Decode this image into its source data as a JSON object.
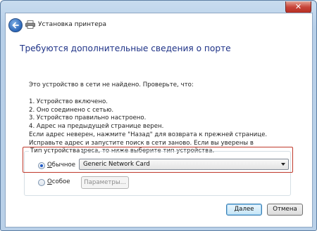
{
  "window": {
    "close_glyph": "✕"
  },
  "wizard": {
    "title": "Установка принтера"
  },
  "heading": "Требуются дополнительные сведения о порте",
  "intro": "Это устройство в сети не найдено. Проверьте, что:",
  "steps": [
    "1.  Устройство включено.",
    "2.  Оно соединено с сетью.",
    "3.  Устройство правильно настроено.",
    "4.  Адрес на предыдущей странице верен."
  ],
  "note": "Если адрес неверен, нажмите \"Назад\" для возврата к прежней странице. Исправьте адрес и запустите поиск в сети заново. Если вы уверены в правильности адреса, то ниже выберите тип устройства.",
  "device_type": {
    "legend": "Тип устройства",
    "standard_label_first": "О",
    "standard_label_rest": "бычное",
    "standard_selected": true,
    "select_value": "Generic Network Card",
    "special_label_first": "О",
    "special_label_rest": "собое",
    "params_label": "Параметры..."
  },
  "footer": {
    "next_label": "Далее",
    "cancel_label": "Отмена"
  },
  "icons": {
    "back": "back-arrow-icon",
    "printer": "printer-icon",
    "dropdown": "chevron-down-icon"
  }
}
